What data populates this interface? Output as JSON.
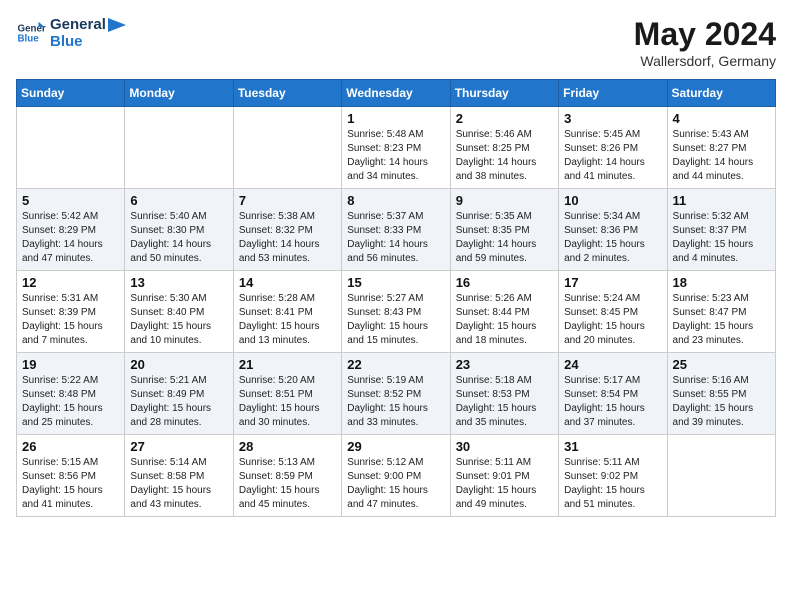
{
  "header": {
    "logo_line1": "General",
    "logo_line2": "Blue",
    "month_title": "May 2024",
    "location": "Wallersdorf, Germany"
  },
  "weekdays": [
    "Sunday",
    "Monday",
    "Tuesday",
    "Wednesday",
    "Thursday",
    "Friday",
    "Saturday"
  ],
  "weeks": [
    [
      {
        "day": "",
        "info": ""
      },
      {
        "day": "",
        "info": ""
      },
      {
        "day": "",
        "info": ""
      },
      {
        "day": "1",
        "info": "Sunrise: 5:48 AM\nSunset: 8:23 PM\nDaylight: 14 hours and 34 minutes."
      },
      {
        "day": "2",
        "info": "Sunrise: 5:46 AM\nSunset: 8:25 PM\nDaylight: 14 hours and 38 minutes."
      },
      {
        "day": "3",
        "info": "Sunrise: 5:45 AM\nSunset: 8:26 PM\nDaylight: 14 hours and 41 minutes."
      },
      {
        "day": "4",
        "info": "Sunrise: 5:43 AM\nSunset: 8:27 PM\nDaylight: 14 hours and 44 minutes."
      }
    ],
    [
      {
        "day": "5",
        "info": "Sunrise: 5:42 AM\nSunset: 8:29 PM\nDaylight: 14 hours and 47 minutes."
      },
      {
        "day": "6",
        "info": "Sunrise: 5:40 AM\nSunset: 8:30 PM\nDaylight: 14 hours and 50 minutes."
      },
      {
        "day": "7",
        "info": "Sunrise: 5:38 AM\nSunset: 8:32 PM\nDaylight: 14 hours and 53 minutes."
      },
      {
        "day": "8",
        "info": "Sunrise: 5:37 AM\nSunset: 8:33 PM\nDaylight: 14 hours and 56 minutes."
      },
      {
        "day": "9",
        "info": "Sunrise: 5:35 AM\nSunset: 8:35 PM\nDaylight: 14 hours and 59 minutes."
      },
      {
        "day": "10",
        "info": "Sunrise: 5:34 AM\nSunset: 8:36 PM\nDaylight: 15 hours and 2 minutes."
      },
      {
        "day": "11",
        "info": "Sunrise: 5:32 AM\nSunset: 8:37 PM\nDaylight: 15 hours and 4 minutes."
      }
    ],
    [
      {
        "day": "12",
        "info": "Sunrise: 5:31 AM\nSunset: 8:39 PM\nDaylight: 15 hours and 7 minutes."
      },
      {
        "day": "13",
        "info": "Sunrise: 5:30 AM\nSunset: 8:40 PM\nDaylight: 15 hours and 10 minutes."
      },
      {
        "day": "14",
        "info": "Sunrise: 5:28 AM\nSunset: 8:41 PM\nDaylight: 15 hours and 13 minutes."
      },
      {
        "day": "15",
        "info": "Sunrise: 5:27 AM\nSunset: 8:43 PM\nDaylight: 15 hours and 15 minutes."
      },
      {
        "day": "16",
        "info": "Sunrise: 5:26 AM\nSunset: 8:44 PM\nDaylight: 15 hours and 18 minutes."
      },
      {
        "day": "17",
        "info": "Sunrise: 5:24 AM\nSunset: 8:45 PM\nDaylight: 15 hours and 20 minutes."
      },
      {
        "day": "18",
        "info": "Sunrise: 5:23 AM\nSunset: 8:47 PM\nDaylight: 15 hours and 23 minutes."
      }
    ],
    [
      {
        "day": "19",
        "info": "Sunrise: 5:22 AM\nSunset: 8:48 PM\nDaylight: 15 hours and 25 minutes."
      },
      {
        "day": "20",
        "info": "Sunrise: 5:21 AM\nSunset: 8:49 PM\nDaylight: 15 hours and 28 minutes."
      },
      {
        "day": "21",
        "info": "Sunrise: 5:20 AM\nSunset: 8:51 PM\nDaylight: 15 hours and 30 minutes."
      },
      {
        "day": "22",
        "info": "Sunrise: 5:19 AM\nSunset: 8:52 PM\nDaylight: 15 hours and 33 minutes."
      },
      {
        "day": "23",
        "info": "Sunrise: 5:18 AM\nSunset: 8:53 PM\nDaylight: 15 hours and 35 minutes."
      },
      {
        "day": "24",
        "info": "Sunrise: 5:17 AM\nSunset: 8:54 PM\nDaylight: 15 hours and 37 minutes."
      },
      {
        "day": "25",
        "info": "Sunrise: 5:16 AM\nSunset: 8:55 PM\nDaylight: 15 hours and 39 minutes."
      }
    ],
    [
      {
        "day": "26",
        "info": "Sunrise: 5:15 AM\nSunset: 8:56 PM\nDaylight: 15 hours and 41 minutes."
      },
      {
        "day": "27",
        "info": "Sunrise: 5:14 AM\nSunset: 8:58 PM\nDaylight: 15 hours and 43 minutes."
      },
      {
        "day": "28",
        "info": "Sunrise: 5:13 AM\nSunset: 8:59 PM\nDaylight: 15 hours and 45 minutes."
      },
      {
        "day": "29",
        "info": "Sunrise: 5:12 AM\nSunset: 9:00 PM\nDaylight: 15 hours and 47 minutes."
      },
      {
        "day": "30",
        "info": "Sunrise: 5:11 AM\nSunset: 9:01 PM\nDaylight: 15 hours and 49 minutes."
      },
      {
        "day": "31",
        "info": "Sunrise: 5:11 AM\nSunset: 9:02 PM\nDaylight: 15 hours and 51 minutes."
      },
      {
        "day": "",
        "info": ""
      }
    ]
  ]
}
